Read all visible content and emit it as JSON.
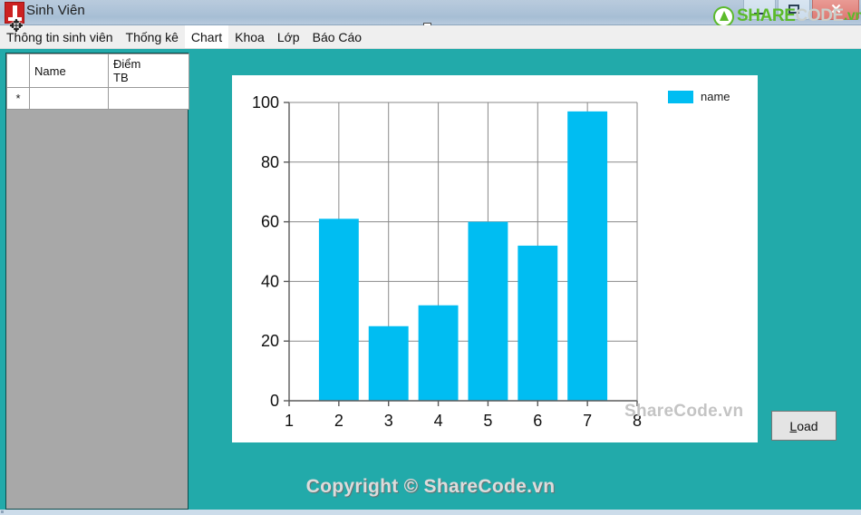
{
  "window": {
    "title": "Sinh Viên",
    "icon": "app-icon",
    "buttons": {
      "minimize": "minimize-icon",
      "maximize": "maximize-icon",
      "close": "✕"
    }
  },
  "watermark_logo": {
    "share": "SHARE",
    "code": "CODE",
    "vn": ".vn"
  },
  "menu": {
    "items": [
      {
        "label": "Thông tin sinh viên",
        "active": false
      },
      {
        "label": "Thống kê",
        "active": false
      },
      {
        "label": "Chart",
        "active": true
      },
      {
        "label": "Khoa",
        "active": false
      },
      {
        "label": "Lớp",
        "active": false
      },
      {
        "label": "Báo Cáo",
        "active": false
      }
    ]
  },
  "grid": {
    "columns": [
      "",
      "Name",
      "Điểm\nTB"
    ],
    "column_name": "Name",
    "column_diem_line1": "Điểm",
    "column_diem_line2": "TB",
    "new_row_marker": "*",
    "rows": []
  },
  "chart_watermark": "ShareCode.vn",
  "legend": {
    "label": "name",
    "swatch_color": "#00bdf2"
  },
  "load_button": {
    "accesskey": "L",
    "rest": "oad"
  },
  "footer": {
    "copyright": "Copyright © ShareCode.vn"
  },
  "colors": {
    "form_background": "#22aaaa",
    "bar": "#00bdf2",
    "grid_empty": "#a8a8a8",
    "titlebar": "#aec3d8",
    "menustrip": "#efefef",
    "close_button": "#dd7a73",
    "logo_green": "#5bba2a"
  },
  "chart_data": {
    "type": "bar",
    "title": "",
    "xlabel": "",
    "ylabel": "",
    "series": [
      {
        "name": "name",
        "color": "#00bdf2",
        "x": [
          2,
          3,
          4,
          5,
          6,
          7
        ],
        "values": [
          61,
          25,
          32,
          60,
          52,
          97
        ]
      }
    ],
    "x_ticks": [
      1,
      2,
      3,
      4,
      5,
      6,
      7,
      8
    ],
    "y_ticks": [
      0,
      20,
      40,
      60,
      80,
      100
    ],
    "xlim": [
      1,
      8
    ],
    "ylim": [
      0,
      100
    ],
    "grid": true,
    "legend_position": "top-right"
  }
}
